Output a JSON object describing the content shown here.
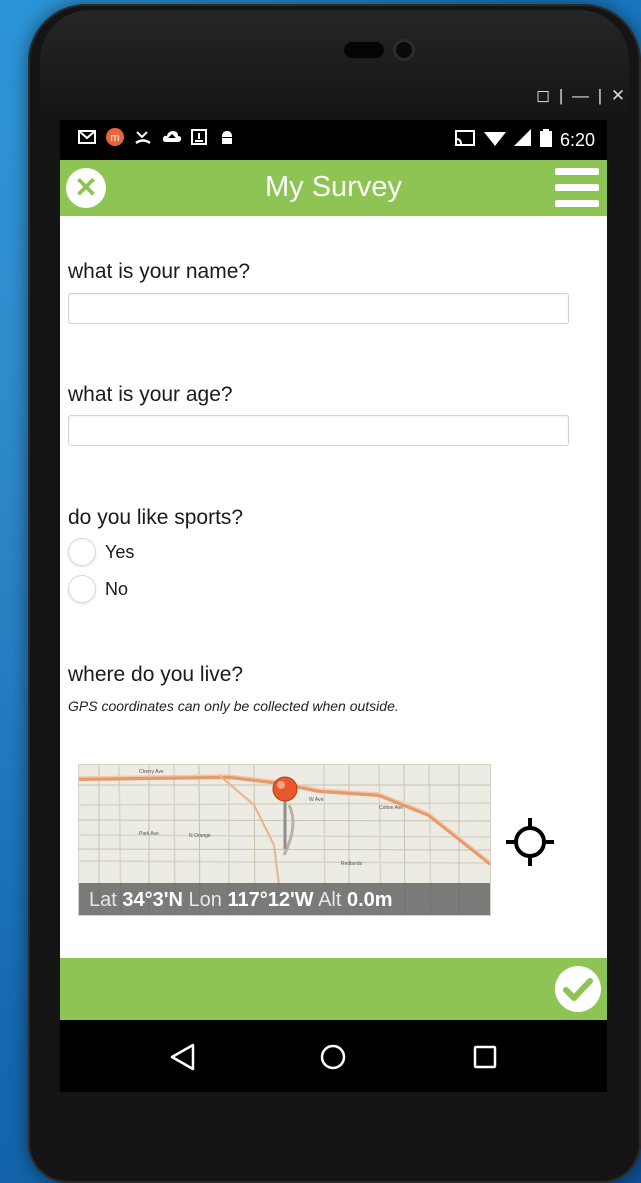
{
  "window": {
    "controls": "◻ | — | ✕"
  },
  "statusbar": {
    "time": "6:20",
    "icons": [
      "gmail-icon",
      "app-m-icon",
      "missed-call-icon",
      "cloud-upload-icon",
      "download-icon",
      "android-icon"
    ],
    "right_icons": [
      "cast-icon",
      "wifi-icon",
      "signal-icon",
      "battery-icon"
    ]
  },
  "header": {
    "title": "My Survey",
    "close_icon": "close-icon",
    "menu_icon": "hamburger-menu-icon"
  },
  "form": {
    "q_name": {
      "label": "what is your name?",
      "value": ""
    },
    "q_age": {
      "label": "what is your age?",
      "value": ""
    },
    "q_sports": {
      "label": "do you like sports?",
      "options": [
        "Yes",
        "No"
      ],
      "selected": null
    },
    "q_location": {
      "label": "where do you live?",
      "hint": "GPS coordinates can only be collected when outside.",
      "coords": {
        "lat_label": "Lat",
        "lat": "34°3'N",
        "lon_label": "Lon",
        "lon": "117°12'W",
        "alt_label": "Alt",
        "alt": "0.0m"
      }
    }
  },
  "footer": {
    "submit_icon": "checkmark-icon"
  },
  "navbar": {
    "icons": [
      "back-icon",
      "home-icon",
      "recents-icon"
    ]
  },
  "colors": {
    "accent": "#8dc454",
    "background": "#1670b8"
  }
}
